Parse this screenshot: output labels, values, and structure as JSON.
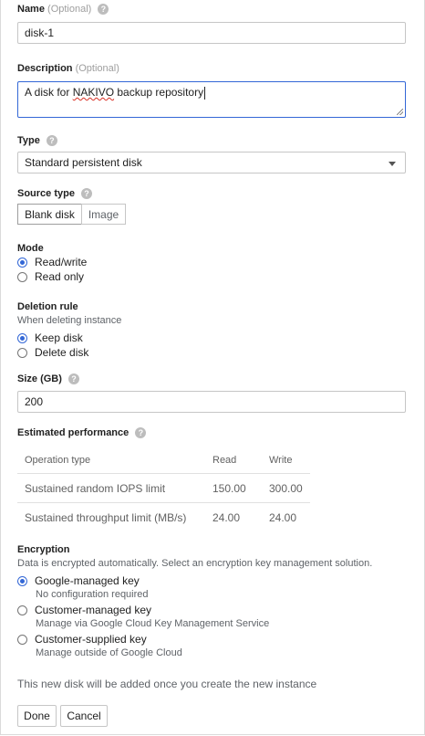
{
  "name": {
    "label": "Name",
    "optional": "(Optional)",
    "value": "disk-1"
  },
  "description": {
    "label": "Description",
    "optional": "(Optional)",
    "value_before": "A disk for ",
    "value_misspelled": "NAKIVO",
    "value_after": " backup repository"
  },
  "type": {
    "label": "Type",
    "selected": "Standard persistent disk"
  },
  "source_type": {
    "label": "Source type",
    "options": [
      "Blank disk",
      "Image"
    ],
    "selected": "Blank disk"
  },
  "mode": {
    "label": "Mode",
    "options": [
      "Read/write",
      "Read only"
    ],
    "selected": "Read/write"
  },
  "deletion_rule": {
    "label": "Deletion rule",
    "sublabel": "When deleting instance",
    "options": [
      "Keep disk",
      "Delete disk"
    ],
    "selected": "Keep disk"
  },
  "size": {
    "label": "Size (GB)",
    "value": "200"
  },
  "performance": {
    "label": "Estimated performance",
    "headers": [
      "Operation type",
      "Read",
      "Write"
    ],
    "rows": [
      [
        "Sustained random IOPS limit",
        "150.00",
        "300.00"
      ],
      [
        "Sustained throughput limit (MB/s)",
        "24.00",
        "24.00"
      ]
    ]
  },
  "encryption": {
    "label": "Encryption",
    "description": "Data is encrypted automatically. Select an encryption key management solution.",
    "options": [
      {
        "label": "Google-managed key",
        "sub": "No configuration required"
      },
      {
        "label": "Customer-managed key",
        "sub": "Manage via Google Cloud Key Management Service"
      },
      {
        "label": "Customer-supplied key",
        "sub": "Manage outside of Google Cloud"
      }
    ],
    "selected": "Google-managed key"
  },
  "footer_note": "This new disk will be added once you create the new instance",
  "buttons": {
    "done": "Done",
    "cancel": "Cancel"
  },
  "colors": {
    "accent": "#3367d6",
    "help_icon": "#bdbdbd"
  }
}
